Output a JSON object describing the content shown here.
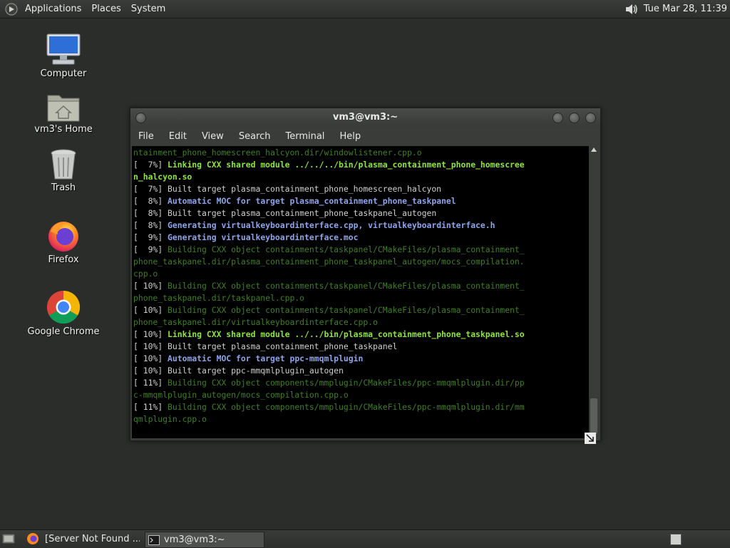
{
  "top_panel": {
    "menus": [
      "Applications",
      "Places",
      "System"
    ],
    "clock": "Tue Mar 28, 11:39"
  },
  "desktop": {
    "icons": [
      {
        "label": "Computer"
      },
      {
        "label": "vm3's Home"
      },
      {
        "label": "Trash"
      },
      {
        "label": "Firefox"
      },
      {
        "label": "Google Chrome"
      }
    ]
  },
  "terminal": {
    "title": "vm3@vm3:~",
    "menu": [
      "File",
      "Edit",
      "View",
      "Search",
      "Terminal",
      "Help"
    ],
    "lines": [
      [
        {
          "t": "ntainment_phone_homescreen_halcyon.dir/windowlistener.cpp.o",
          "c": "d"
        }
      ],
      [
        {
          "t": "[  7%] ",
          "c": "w"
        },
        {
          "t": "Linking CXX shared module ../../../bin/plasma_containment_phone_homescree",
          "c": "g"
        }
      ],
      [
        {
          "t": "n_halcyon.so",
          "c": "g"
        }
      ],
      [
        {
          "t": "[  7%] Built target plasma_containment_phone_homescreen_halcyon",
          "c": "w"
        }
      ],
      [
        {
          "t": "[  8%] ",
          "c": "w"
        },
        {
          "t": "Automatic MOC for target plasma_containment_phone_taskpanel",
          "c": "b"
        }
      ],
      [
        {
          "t": "[  8%] Built target plasma_containment_phone_taskpanel_autogen",
          "c": "w"
        }
      ],
      [
        {
          "t": "[  8%] ",
          "c": "w"
        },
        {
          "t": "Generating virtualkeyboardinterface.cpp, virtualkeyboardinterface.h",
          "c": "b"
        }
      ],
      [
        {
          "t": "[  9%] ",
          "c": "w"
        },
        {
          "t": "Generating virtualkeyboardinterface.moc",
          "c": "b"
        }
      ],
      [
        {
          "t": "[  9%] ",
          "c": "w"
        },
        {
          "t": "Building CXX object containments/taskpanel/CMakeFiles/plasma_containment_",
          "c": "d"
        }
      ],
      [
        {
          "t": "phone_taskpanel.dir/plasma_containment_phone_taskpanel_autogen/mocs_compilation.",
          "c": "d"
        }
      ],
      [
        {
          "t": "cpp.o",
          "c": "d"
        }
      ],
      [
        {
          "t": "[ 10%] ",
          "c": "w"
        },
        {
          "t": "Building CXX object containments/taskpanel/CMakeFiles/plasma_containment_",
          "c": "d"
        }
      ],
      [
        {
          "t": "phone_taskpanel.dir/taskpanel.cpp.o",
          "c": "d"
        }
      ],
      [
        {
          "t": "[ 10%] ",
          "c": "w"
        },
        {
          "t": "Building CXX object containments/taskpanel/CMakeFiles/plasma_containment_",
          "c": "d"
        }
      ],
      [
        {
          "t": "phone_taskpanel.dir/virtualkeyboardinterface.cpp.o",
          "c": "d"
        }
      ],
      [
        {
          "t": "[ 10%] ",
          "c": "w"
        },
        {
          "t": "Linking CXX shared module ../../bin/plasma_containment_phone_taskpanel.so",
          "c": "g"
        }
      ],
      [
        {
          "t": "[ 10%] Built target plasma_containment_phone_taskpanel",
          "c": "w"
        }
      ],
      [
        {
          "t": "[ 10%] ",
          "c": "w"
        },
        {
          "t": "Automatic MOC for target ppc-mmqmlplugin",
          "c": "b"
        }
      ],
      [
        {
          "t": "[ 10%] Built target ppc-mmqmlplugin_autogen",
          "c": "w"
        }
      ],
      [
        {
          "t": "[ 11%] ",
          "c": "w"
        },
        {
          "t": "Building CXX object components/mmplugin/CMakeFiles/ppc-mmqmlplugin.dir/pp",
          "c": "d"
        }
      ],
      [
        {
          "t": "c-mmqmlplugin_autogen/mocs_compilation.cpp.o",
          "c": "d"
        }
      ],
      [
        {
          "t": "[ 11%] ",
          "c": "w"
        },
        {
          "t": "Building CXX object components/mmplugin/CMakeFiles/ppc-mmqmlplugin.dir/mm",
          "c": "d"
        }
      ],
      [
        {
          "t": "qmlplugin.cpp.o",
          "c": "d"
        }
      ]
    ]
  },
  "taskbar": {
    "tasks": [
      {
        "label": "[Server Not Found ..."
      },
      {
        "label": "vm3@vm3:~"
      }
    ]
  },
  "colors": {
    "desktop_bg": "#2b2d2a",
    "terminal_bg": "#000000",
    "bold_green": "#8ee53f",
    "bold_blue": "#8fa4e8",
    "dim_green": "#3f7f24"
  }
}
